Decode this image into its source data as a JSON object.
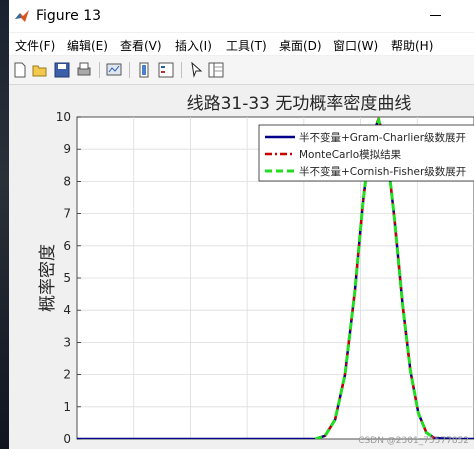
{
  "window": {
    "title": "Figure 13"
  },
  "menu": [
    "文件(F)",
    "编辑(E)",
    "查看(V)",
    "插入(I)",
    "工具(T)",
    "桌面(D)",
    "窗口(W)",
    "帮助(H)"
  ],
  "toolbar_icons": [
    "new-figure-icon",
    "open-file-icon",
    "save-icon",
    "print-icon",
    "link-plot-icon",
    "insert-colorbar-icon",
    "insert-legend-icon",
    "pointer-icon",
    "property-inspector-icon"
  ],
  "watermark": "CSDN @2301_75577852",
  "chart_data": {
    "type": "line",
    "title": "线路31-33 无功概率密度曲线",
    "xlabel": "",
    "ylabel": "概率密度",
    "ylim": [
      0,
      10
    ],
    "xlim": [
      0,
      1
    ],
    "yticks": [
      "0",
      "1",
      "2",
      "3",
      "4",
      "5",
      "6",
      "7",
      "8",
      "9",
      "10"
    ],
    "grid": true,
    "legend_position": "top-right",
    "series": [
      {
        "name": "半不变量+Gram-Charlier级数展开",
        "color": "#00008b",
        "style": "solid",
        "x": [
          0,
          0.05,
          0.1,
          0.15,
          0.2,
          0.25,
          0.3,
          0.35,
          0.4,
          0.45,
          0.5,
          0.55,
          0.6,
          0.625,
          0.65,
          0.675,
          0.7,
          0.72,
          0.74,
          0.76,
          0.78,
          0.8,
          0.82,
          0.84,
          0.86,
          0.88,
          0.9,
          0.95,
          1.0
        ],
        "y": [
          0,
          0,
          0,
          0,
          0,
          0,
          0,
          0,
          0,
          0,
          0,
          0,
          0,
          0.1,
          0.6,
          2.0,
          4.6,
          7.3,
          9.4,
          9.9,
          9.0,
          6.8,
          4.2,
          2.1,
          0.8,
          0.2,
          0.03,
          0,
          0
        ]
      },
      {
        "name": "MonteCarlo模拟结果",
        "color": "#cc0000",
        "style": "dashdot",
        "x": [
          0.6,
          0.625,
          0.65,
          0.675,
          0.7,
          0.72,
          0.74,
          0.76,
          0.78,
          0.8,
          0.82,
          0.84,
          0.86,
          0.88,
          0.9
        ],
        "y": [
          0,
          0.1,
          0.6,
          2.0,
          4.6,
          7.3,
          9.4,
          9.95,
          9.0,
          6.8,
          4.2,
          2.1,
          0.8,
          0.2,
          0.03
        ]
      },
      {
        "name": "半不变量+Cornish-Fisher级数展开",
        "color": "#22dd22",
        "style": "dashed",
        "x": [
          0.6,
          0.625,
          0.65,
          0.675,
          0.7,
          0.72,
          0.74,
          0.76,
          0.78,
          0.8,
          0.82,
          0.84,
          0.86,
          0.88,
          0.9
        ],
        "y": [
          0,
          0.1,
          0.6,
          2.0,
          4.6,
          7.3,
          9.4,
          9.9,
          9.0,
          6.8,
          4.2,
          2.1,
          0.8,
          0.2,
          0.03
        ]
      }
    ]
  }
}
